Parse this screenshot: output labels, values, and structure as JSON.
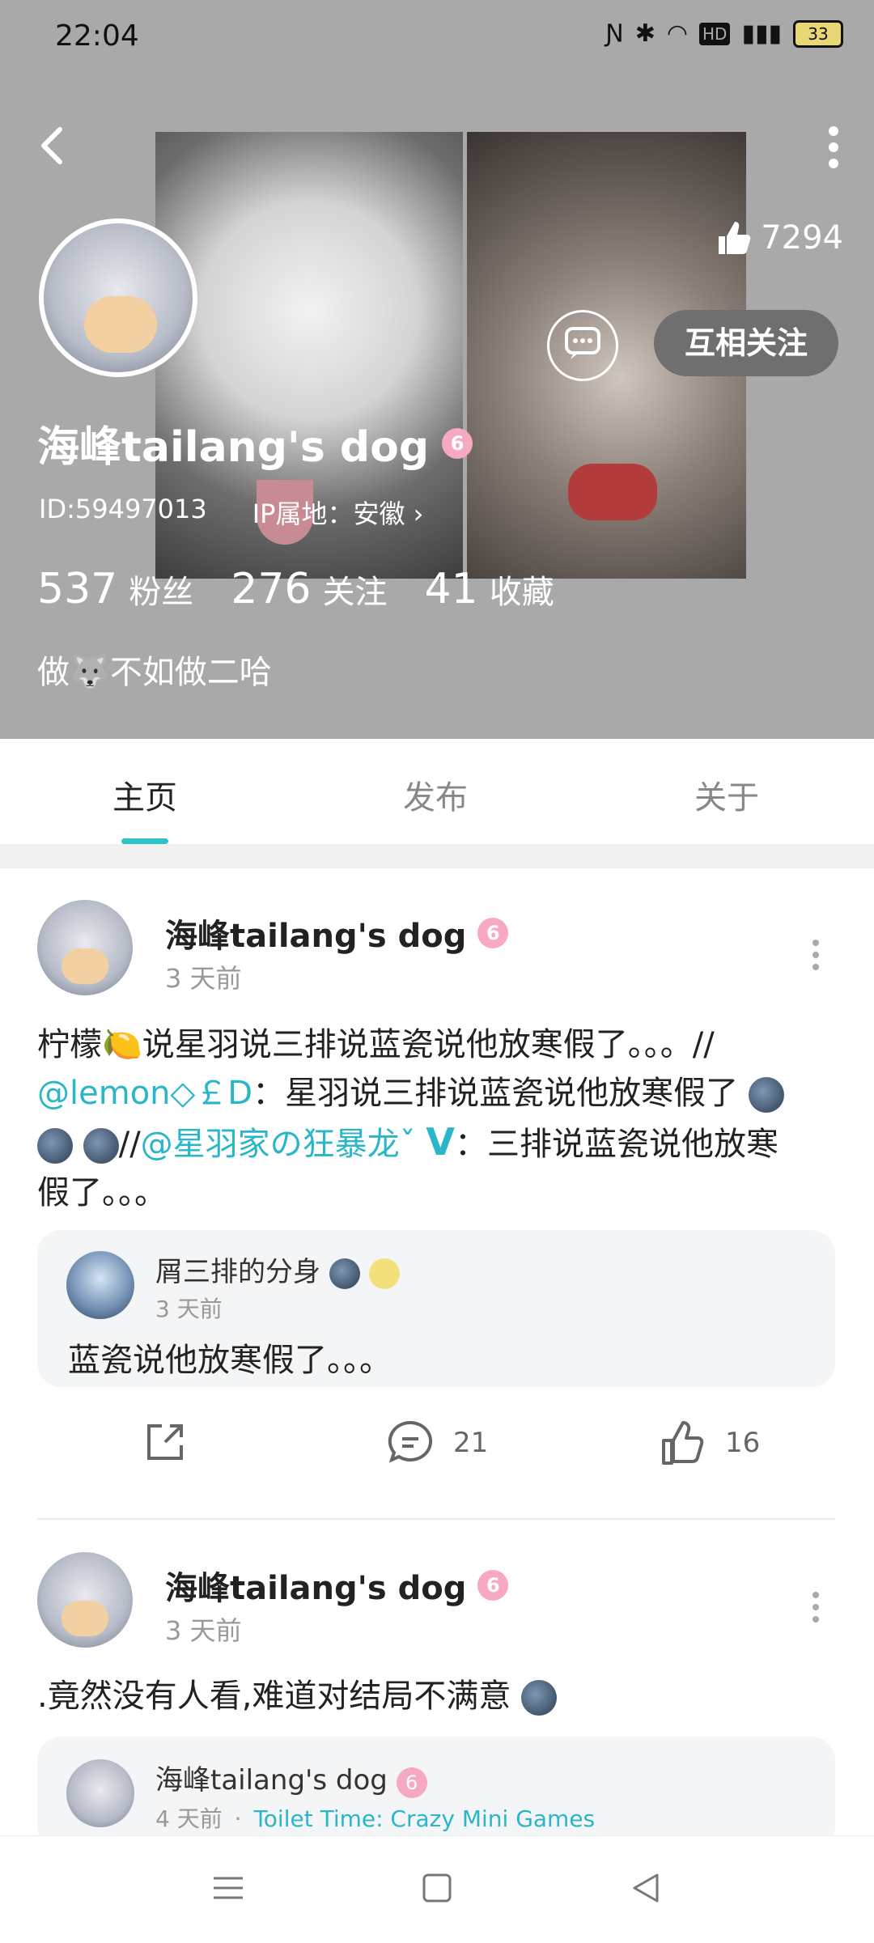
{
  "status": {
    "time": "22:04",
    "battery": "33",
    "icons": [
      "nfc-icon",
      "bluetooth-icon",
      "wifi-icon",
      "hd-icon",
      "signal-5g-icon"
    ]
  },
  "profile": {
    "name": "海峰tailang's dog",
    "level_badge": "6",
    "likes": "7294",
    "follow_label": "互相关注",
    "id_text": "ID:59497013",
    "ip_text": "IP属地：安徽",
    "stats": [
      {
        "num": "537",
        "label": "粉丝"
      },
      {
        "num": "276",
        "label": "关注"
      },
      {
        "num": "41",
        "label": "收藏"
      }
    ],
    "bio_prefix": "做",
    "bio_emoji": "🐺",
    "bio_suffix": "不如做二哈"
  },
  "tabs": [
    {
      "label": "主页"
    },
    {
      "label": "发布"
    },
    {
      "label": "关于"
    }
  ],
  "posts": [
    {
      "author": "海峰tailang's dog",
      "badge": "6",
      "time": "3 天前",
      "text_line1": "柠檬🍋说星羽说三排说蓝瓷说他放寒假了。。。//",
      "mention1": "@lemon◇￡D",
      "text_line2": "：星羽说三排说蓝瓷说他放寒假了",
      "slashes": "//",
      "mention2": "@星羽家の狂暴龙ˇ",
      "vbadge": "V",
      "text_line3": "：三排说蓝瓷说他放寒",
      "text_line4": "假了。。。",
      "quote": {
        "author": "屑三排的分身",
        "time": "3 天前",
        "text": "蓝瓷说他放寒假了。。。"
      },
      "comments": "21",
      "likes": "16"
    },
    {
      "author": "海峰tailang's dog",
      "badge": "6",
      "time": "3 天前",
      "text": ".竟然没有人看,难道对结局不满意",
      "quote": {
        "author": "海峰tailang's dog",
        "badge": "6",
        "time": "4 天前",
        "game": "Toilet Time: Crazy Mini Games"
      }
    }
  ],
  "colors": {
    "accent": "#2ec4c7",
    "link": "#2ab6c9",
    "header_bg": "#a9a9a9"
  }
}
